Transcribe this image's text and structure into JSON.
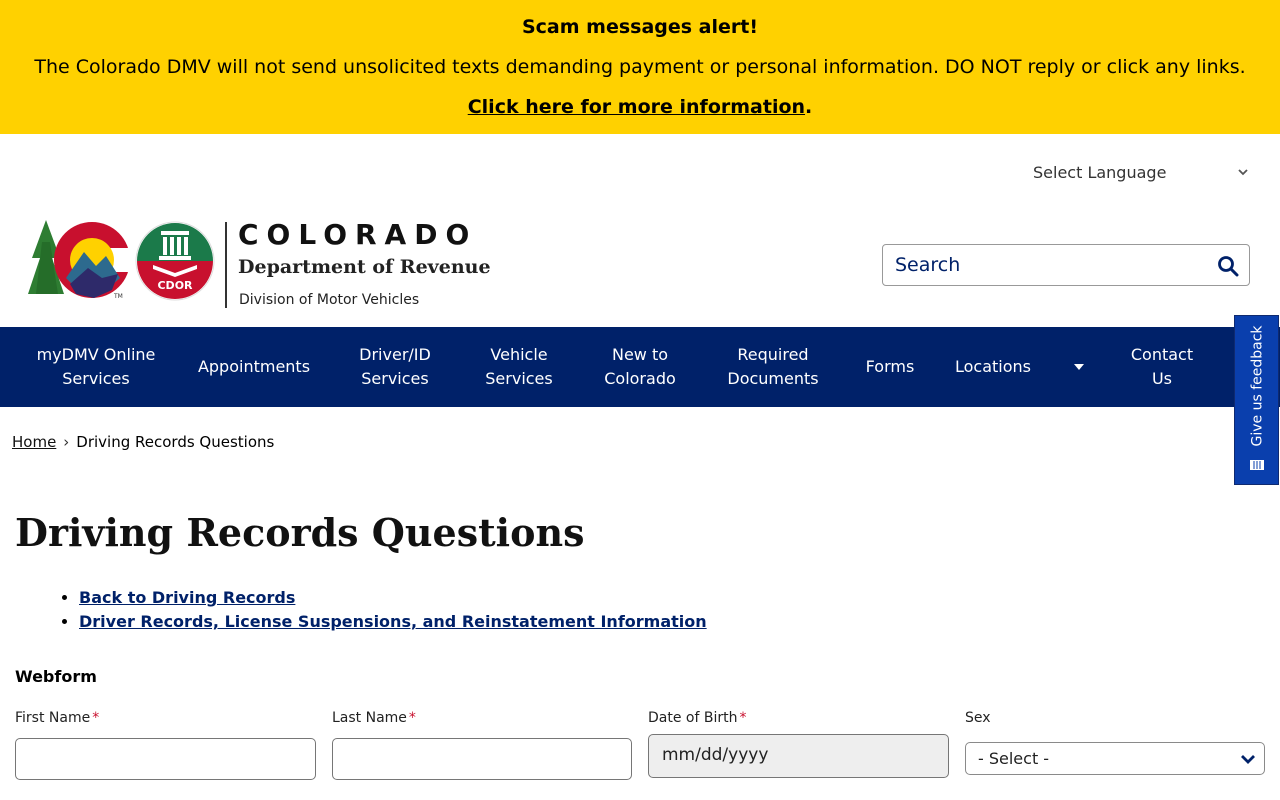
{
  "alert": {
    "title": "Scam messages alert!",
    "message": "The Colorado DMV will not send unsolicited texts demanding payment or personal information. DO NOT reply or click any links.",
    "link_label": "Click here for more information",
    "link_suffix": ".",
    "background_color": "#ffd100"
  },
  "language": {
    "label": "Select Language",
    "icon": "chevron-down-icon"
  },
  "logo": {
    "state": "COLORADO",
    "department": "Department of Revenue",
    "division": "Division of Motor Vehicles",
    "seal_text": "CDOR",
    "tm": "TM"
  },
  "search": {
    "placeholder": "Search",
    "icon": "search-icon"
  },
  "nav": {
    "background_color": "#002169",
    "items": [
      {
        "line1": "myDMV Online",
        "line2": "Services"
      },
      {
        "line1": "Appointments",
        "line2": ""
      },
      {
        "line1": "Driver/ID",
        "line2": "Services"
      },
      {
        "line1": "Vehicle",
        "line2": "Services"
      },
      {
        "line1": "New to",
        "line2": "Colorado"
      },
      {
        "line1": "Required",
        "line2": "Documents"
      },
      {
        "line1": "Forms",
        "line2": ""
      },
      {
        "line1": "Locations",
        "line2": ""
      },
      {
        "line1": "Contact",
        "line2": "Us"
      }
    ]
  },
  "feedback": {
    "label": "Give us feedback",
    "icon": "feedback-icon"
  },
  "breadcrumb": {
    "home": "Home",
    "separator": "›",
    "current": "Driving Records Questions"
  },
  "page": {
    "title": "Driving Records Questions",
    "links": [
      "Back to Driving Records",
      "Driver Records, License Suspensions, and Reinstatement Information"
    ]
  },
  "webform": {
    "title": "Webform",
    "required_mark": "*",
    "first_name_label": "First Name",
    "last_name_label": "Last Name",
    "dob_label": "Date of Birth",
    "dob_placeholder": "mm/dd/yyyy",
    "sex_label": "Sex",
    "sex_selected": "- Select -"
  }
}
